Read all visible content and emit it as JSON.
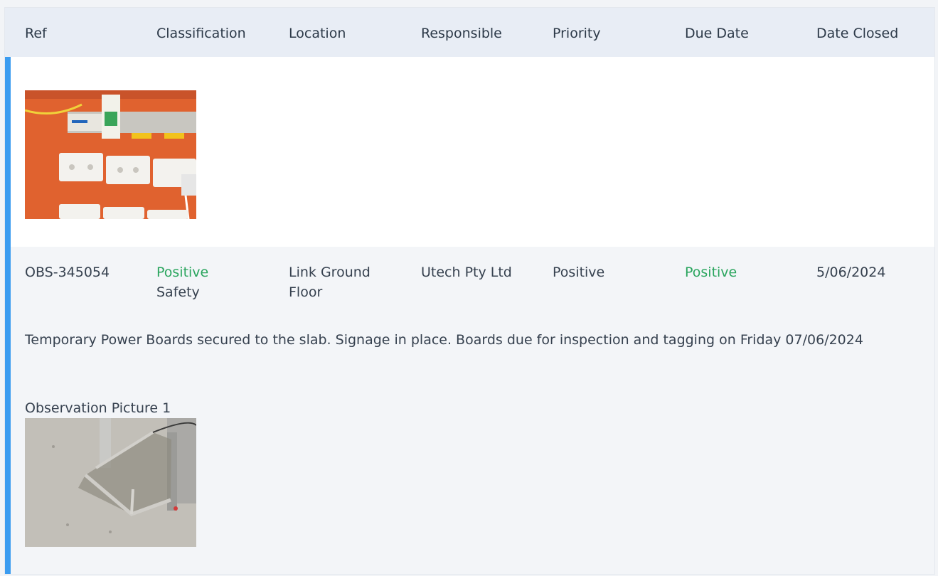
{
  "table": {
    "columns": [
      "Ref",
      "Classification",
      "Location",
      "Responsible",
      "Priority",
      "Due Date",
      "Date Closed"
    ]
  },
  "record": {
    "ref": "OBS-345054",
    "classification_top": "Positive",
    "classification_bottom": "Safety",
    "location_line1": "Link Ground",
    "location_line2": "Floor",
    "responsible": "Utech Pty Ltd",
    "priority": "Positive",
    "due_date": "Positive",
    "date_closed": "5/06/2024",
    "description": "Temporary Power Boards secured to the slab. Signage in place. Boards due for inspection and tagging on Friday 07/06/2024",
    "picture_caption": "Observation Picture 1"
  },
  "colors": {
    "accent": "#3b9cf0",
    "positive": "#2aa55e",
    "header_bg": "#e8edf5"
  }
}
